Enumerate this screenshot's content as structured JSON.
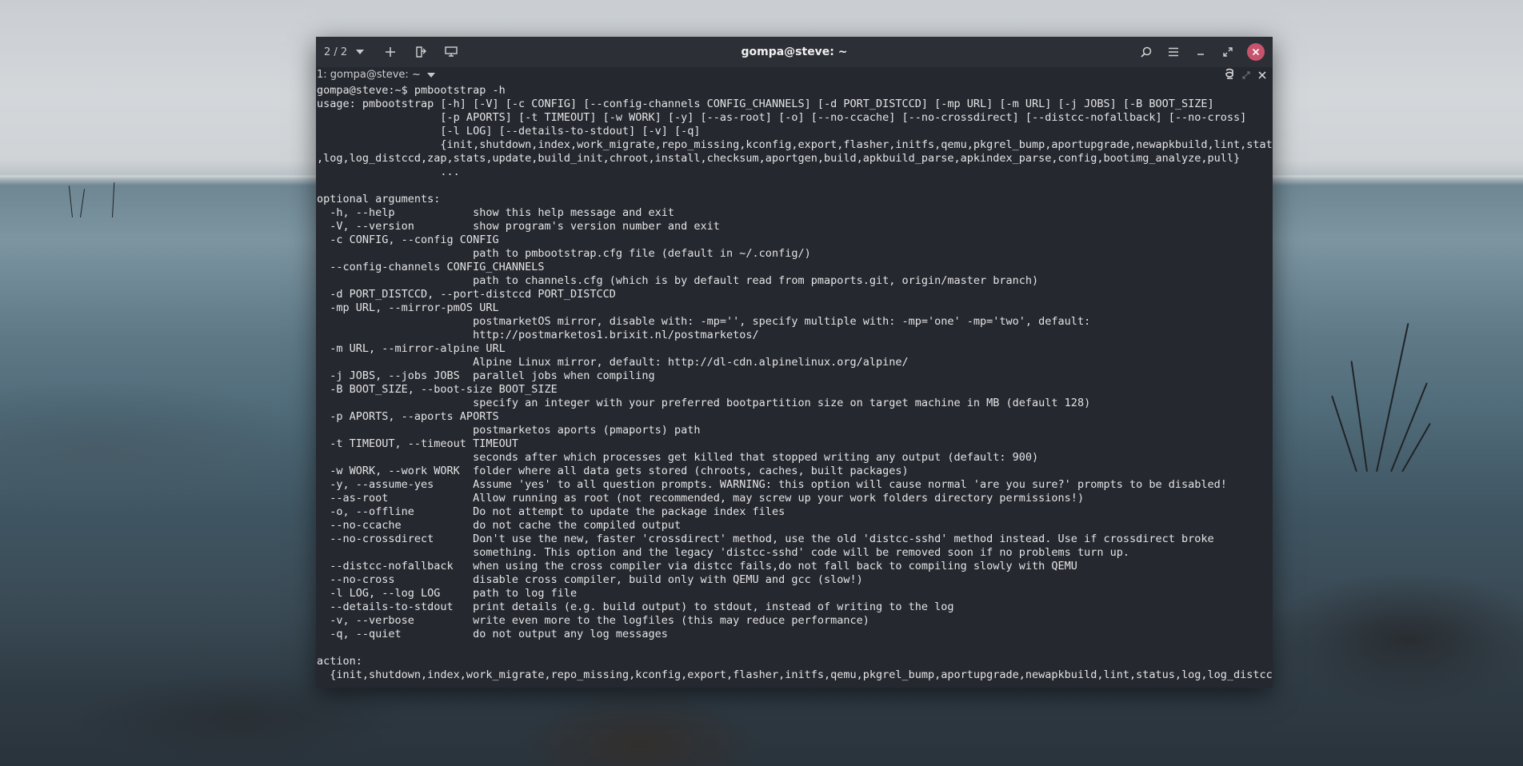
{
  "window": {
    "title": "gompa@steve: ~",
    "tab_counter": "2 / 2",
    "tab_label": "1: gompa@steve: ~"
  },
  "icons": {
    "dropdown": "chevron-down-icon",
    "new_tab": "plus-icon",
    "detach": "detach-tab-icon",
    "preferences": "display-icon",
    "search": "search-icon",
    "menu": "hamburger-menu-icon",
    "minimize": "minimize-icon",
    "maximize": "maximize-icon",
    "close": "close-icon",
    "broadcast": "broadcast-icon",
    "split_toggle": "split-toggle-icon",
    "close_pane": "close-pane-icon"
  },
  "colors": {
    "window_bg": "#262830",
    "titlebar_bg": "#2d2f37",
    "close_button": "#c8536d",
    "text": "#e4e4e4"
  },
  "terminal": {
    "lines": [
      "gompa@steve:~$ pmbootstrap -h",
      "usage: pmbootstrap [-h] [-V] [-c CONFIG] [--config-channels CONFIG_CHANNELS] [-d PORT_DISTCCD] [-mp URL] [-m URL] [-j JOBS] [-B BOOT_SIZE]",
      "                   [-p APORTS] [-t TIMEOUT] [-w WORK] [-y] [--as-root] [-o] [--no-ccache] [--no-crossdirect] [--distcc-nofallback] [--no-cross]",
      "                   [-l LOG] [--details-to-stdout] [-v] [-q]",
      "                   {init,shutdown,index,work_migrate,repo_missing,kconfig,export,flasher,initfs,qemu,pkgrel_bump,aportupgrade,newapkbuild,lint,status",
      ",log,log_distccd,zap,stats,update,build_init,chroot,install,checksum,aportgen,build,apkbuild_parse,apkindex_parse,config,bootimg_analyze,pull}",
      "                   ...",
      "",
      "optional arguments:",
      "  -h, --help            show this help message and exit",
      "  -V, --version         show program's version number and exit",
      "  -c CONFIG, --config CONFIG",
      "                        path to pmbootstrap.cfg file (default in ~/.config/)",
      "  --config-channels CONFIG_CHANNELS",
      "                        path to channels.cfg (which is by default read from pmaports.git, origin/master branch)",
      "  -d PORT_DISTCCD, --port-distccd PORT_DISTCCD",
      "  -mp URL, --mirror-pmOS URL",
      "                        postmarketOS mirror, disable with: -mp='', specify multiple with: -mp='one' -mp='two', default:",
      "                        http://postmarketos1.brixit.nl/postmarketos/",
      "  -m URL, --mirror-alpine URL",
      "                        Alpine Linux mirror, default: http://dl-cdn.alpinelinux.org/alpine/",
      "  -j JOBS, --jobs JOBS  parallel jobs when compiling",
      "  -B BOOT_SIZE, --boot-size BOOT_SIZE",
      "                        specify an integer with your preferred bootpartition size on target machine in MB (default 128)",
      "  -p APORTS, --aports APORTS",
      "                        postmarketos aports (pmaports) path",
      "  -t TIMEOUT, --timeout TIMEOUT",
      "                        seconds after which processes get killed that stopped writing any output (default: 900)",
      "  -w WORK, --work WORK  folder where all data gets stored (chroots, caches, built packages)",
      "  -y, --assume-yes      Assume 'yes' to all question prompts. WARNING: this option will cause normal 'are you sure?' prompts to be disabled!",
      "  --as-root             Allow running as root (not recommended, may screw up your work folders directory permissions!)",
      "  -o, --offline         Do not attempt to update the package index files",
      "  --no-ccache           do not cache the compiled output",
      "  --no-crossdirect      Don't use the new, faster 'crossdirect' method, use the old 'distcc-sshd' method instead. Use if crossdirect broke",
      "                        something. This option and the legacy 'distcc-sshd' code will be removed soon if no problems turn up.",
      "  --distcc-nofallback   when using the cross compiler via distcc fails,do not fall back to compiling slowly with QEMU",
      "  --no-cross            disable cross compiler, build only with QEMU and gcc (slow!)",
      "  -l LOG, --log LOG     path to log file",
      "  --details-to-stdout   print details (e.g. build output) to stdout, instead of writing to the log",
      "  -v, --verbose         write even more to the logfiles (this may reduce performance)",
      "  -q, --quiet           do not output any log messages",
      "",
      "action:",
      "  {init,shutdown,index,work_migrate,repo_missing,kconfig,export,flasher,initfs,qemu,pkgrel_bump,aportupgrade,newapkbuild,lint,status,log,log_distccd,"
    ]
  }
}
